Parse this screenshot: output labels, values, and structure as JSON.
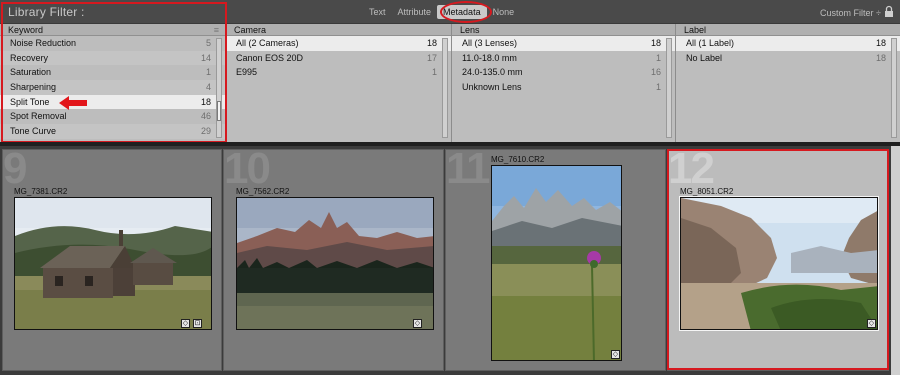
{
  "filter_bar": {
    "title": "Library Filter :",
    "tabs": [
      {
        "label": "Text"
      },
      {
        "label": "Attribute"
      },
      {
        "label": "Metadata"
      },
      {
        "label": "None"
      }
    ],
    "custom_filter": "Custom Filter ÷"
  },
  "columns": [
    {
      "header": "Keyword",
      "header_icon": "≡",
      "rows": [
        {
          "label": "Noise Reduction",
          "count": "5"
        },
        {
          "label": "Recovery",
          "count": "14"
        },
        {
          "label": "Saturation",
          "count": "1"
        },
        {
          "label": "Sharpening",
          "count": "4"
        },
        {
          "label": "Split Tone",
          "count": "18"
        },
        {
          "label": "Spot Removal",
          "count": "46"
        },
        {
          "label": "Tone Curve",
          "count": "29"
        }
      ]
    },
    {
      "header": "Camera",
      "rows": [
        {
          "label": "All (2 Cameras)",
          "count": "18"
        },
        {
          "label": "Canon EOS 20D",
          "count": "17"
        },
        {
          "label": "E995",
          "count": "1"
        }
      ]
    },
    {
      "header": "Lens",
      "rows": [
        {
          "label": "All (3 Lenses)",
          "count": "18"
        },
        {
          "label": "11.0-18.0 mm",
          "count": "1"
        },
        {
          "label": "24.0-135.0 mm",
          "count": "16"
        },
        {
          "label": "Unknown Lens",
          "count": "1"
        }
      ]
    },
    {
      "header": "Label",
      "rows": [
        {
          "label": "All (1 Label)",
          "count": "18"
        },
        {
          "label": "No Label",
          "count": "18"
        }
      ]
    }
  ],
  "grid": [
    {
      "index": "9",
      "filename": "MG_7381.CR2"
    },
    {
      "index": "10",
      "filename": "MG_7562.CR2"
    },
    {
      "index": "11",
      "filename": "MG_7610.CR2"
    },
    {
      "index": "12",
      "filename": "MG_8051.CR2"
    }
  ],
  "colors": {
    "highlight": "#d6191f",
    "panel": "#bdbdbd",
    "toolbar": "#4a4a4a"
  }
}
